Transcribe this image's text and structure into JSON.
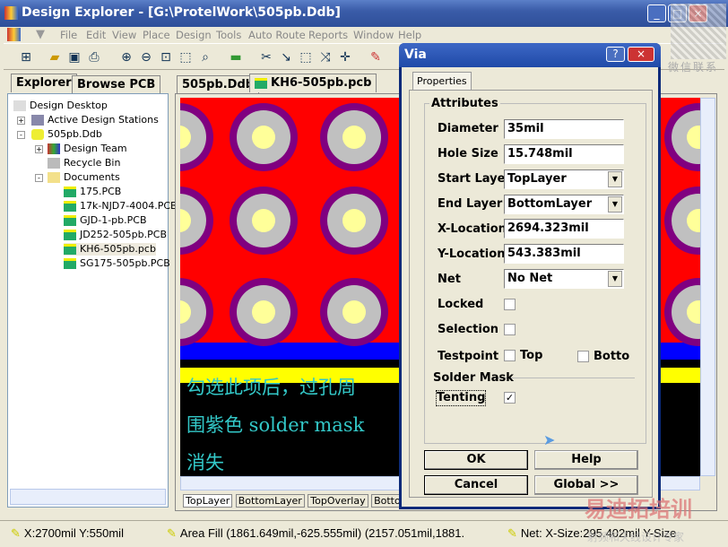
{
  "window": {
    "title": "Design Explorer - [G:\\ProtelWork\\505pb.Ddb]"
  },
  "menu": [
    "File",
    "Edit",
    "View",
    "Place",
    "Design",
    "Tools",
    "Auto Route",
    "Reports",
    "Window",
    "Help"
  ],
  "left_tabs": [
    "Explorer",
    "Browse PCB"
  ],
  "tree": {
    "root": "Design Desktop",
    "stations": "Active Design Stations",
    "db": "505pb.Ddb",
    "team": "Design Team",
    "recycle": "Recycle Bin",
    "documents": "Documents",
    "files": [
      "175.PCB",
      "17k-NJD7-4004.PCB",
      "GJD-1-pb.PCB",
      "JD252-505pb.PCB",
      "KH6-505pb.pcb",
      "SG175-505pb.PCB"
    ],
    "selected": "KH6-505pb.pcb"
  },
  "doc_tabs": [
    "505pb.Ddb",
    "KH6-505pb.pcb"
  ],
  "annotation": [
    "勾选此项后，过孔周",
    "围紫色 solder mask",
    "消失"
  ],
  "layer_tabs": [
    "TopLayer",
    "BottomLayer",
    "TopOverlay",
    "BottomOverlay"
  ],
  "status": {
    "coords": "X:2700mil Y:550mil",
    "object": "Area Fill (1861.649mil,-625.555mil) (2157.051mil,1881.",
    "net": "Net: X-Size:295.402mil Y-Size"
  },
  "dialog": {
    "title": "Via",
    "tab": "Properties",
    "group": "Attributes",
    "fields": {
      "diameter_label": "Diameter",
      "diameter": "35mil",
      "hole_label": "Hole Size",
      "hole": "15.748mil",
      "start_label": "Start Layer",
      "start": "TopLayer",
      "end_label": "End Layer",
      "end": "BottomLayer",
      "x_label": "X-Location",
      "x": "2694.323mil",
      "y_label": "Y-Location",
      "y": "543.383mil",
      "net_label": "Net",
      "net": "No Net"
    },
    "locked_label": "Locked",
    "locked": false,
    "selection_label": "Selection",
    "selection": false,
    "testpoint_label": "Testpoint",
    "top_label": "Top",
    "top": false,
    "bottom_label": "Botto",
    "bottom": false,
    "solder_mask_label": "Solder Mask",
    "tenting_label": "Tenting",
    "tenting": true,
    "buttons": {
      "ok": "OK",
      "help": "Help",
      "cancel": "Cancel",
      "global": "Global >>"
    }
  },
  "watermark": {
    "qr_caption": "微信联系",
    "brand": "易迪拓培训",
    "sub": "射频和天线设计专家"
  },
  "colors": {
    "board": "#ff0000",
    "via_ring": "#800080",
    "via_pad": "#c0c0c0",
    "hole": "#ffff99",
    "blue": "#0000ff",
    "yellow": "#ffff00",
    "text": "#33c8c8"
  }
}
